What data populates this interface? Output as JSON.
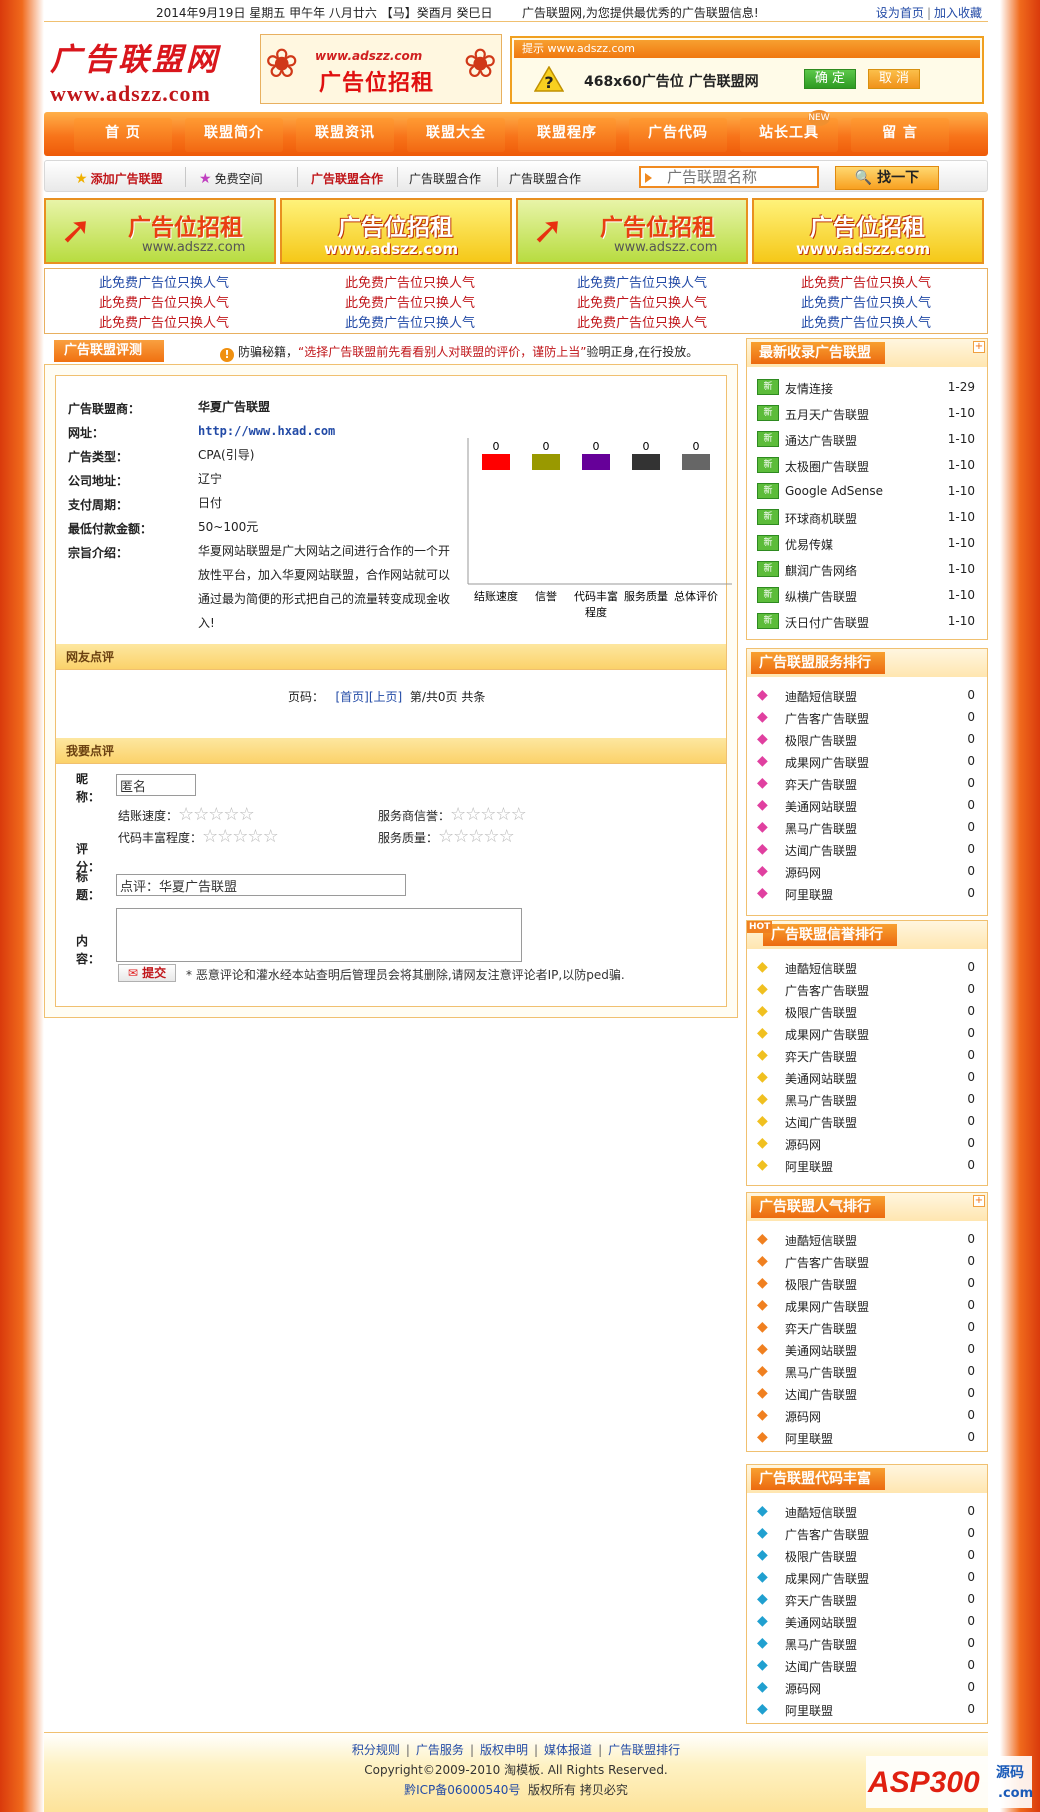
{
  "topbar": {
    "date": "2014年9月19日 星期五 甲午年 八月廿六 【马】癸酉月 癸巳日",
    "slogan": "广告联盟网,为您提供最优秀的广告联盟信息!",
    "set_home": "设为首页",
    "add_fav": "加入收藏"
  },
  "header": {
    "logo_cn": "广告联盟网",
    "logo_en": "www.adszz.com",
    "ad_url": "www.adszz.com",
    "ad_text": "广告位招租",
    "notice_bar": "提示 www.adszz.com",
    "notice_msg": "468x60广告位 广告联盟网",
    "notice_ok": "确 定",
    "notice_cancel": "取 消"
  },
  "nav": {
    "items": [
      "首 页",
      "联盟简介",
      "联盟资讯",
      "联盟大全",
      "联盟程序",
      "广告代码",
      "站长工具",
      "留 言"
    ],
    "new_badge": "NEW"
  },
  "subnav": {
    "add_union": "添加广告联盟",
    "free_space": "免费空间",
    "coop1": "广告联盟合作",
    "coop2": "广告联盟合作",
    "coop3": "广告联盟合作",
    "search_placeholder": "广告联盟名称",
    "search_btn": "找一下"
  },
  "banners": {
    "text": "广告位招租",
    "url": "www.adszz.com"
  },
  "textads": {
    "text": "此免费广告位只换人气"
  },
  "colors": {
    "accent": "#f07010",
    "link_blue": "#224aa6",
    "link_red": "#c0161a",
    "bar1": "#ff0000",
    "bar2": "#999900",
    "bar3": "#660099",
    "bar4": "#333333",
    "bar5": "#666666"
  },
  "main": {
    "tab": "广告联盟评测",
    "tip_prefix": "防骗秘籍，",
    "tip_quote": "“选择广告联盟前先看看别人对联盟的评价，谨防上当”",
    "tip_suffix": "验明正身,在行投放。",
    "info": [
      {
        "k": "广告联盟商：",
        "v": "华夏广告联盟"
      },
      {
        "k": "网址：",
        "v": "http://www.hxad.com"
      },
      {
        "k": "广告类型：",
        "v": "CPA(引导)"
      },
      {
        "k": "公司地址：",
        "v": "辽宁"
      },
      {
        "k": "支付周期：",
        "v": "日付"
      },
      {
        "k": "最低付款金额：",
        "v": "50~100元"
      },
      {
        "k": "宗旨介绍：",
        "v": "华夏网站联盟是广大网站之间进行合作的一个开放性平台，加入华夏网站联盟，合作网站就可以通过最为简便的形式把自己的流量转变成现金收入!"
      }
    ],
    "comments_title": "网友点评",
    "pager_label": "页码：",
    "pager_first": "[首页]",
    "pager_prev": "[上页]",
    "pager_status": "第/共0页 共条",
    "review_title": "我要点评",
    "form": {
      "nick_label": "昵称：",
      "nick_value": "匿名",
      "score_label": "评分：",
      "speed_label": "结账速度：",
      "credit_label": "服务商信誉：",
      "code_label": "代码丰富程度：",
      "quality_label": "服务质量：",
      "title_label": "标题：",
      "title_value": "点评：华夏广告联盟",
      "content_label": "内容：",
      "submit": "提交",
      "note": "* 恶意评论和灌水经本站查明后管理员会将其删除,请网友注意评论者IP,以防ped骗."
    }
  },
  "chart_data": {
    "type": "bar",
    "categories": [
      "结账速度",
      "信誉",
      "代码丰富程度",
      "服务质量",
      "总体评价"
    ],
    "values": [
      0,
      0,
      0,
      0,
      0
    ],
    "ylim": [
      0,
      5
    ],
    "colors": [
      "#ff0000",
      "#999900",
      "#660099",
      "#333333",
      "#666666"
    ],
    "grid": false
  },
  "side_latest": {
    "title": "最新收录广告联盟",
    "items": [
      {
        "name": "友情连接",
        "val": "1-29"
      },
      {
        "name": "五月天广告联盟",
        "val": "1-10"
      },
      {
        "name": "通达广告联盟",
        "val": "1-10"
      },
      {
        "name": "太极圈广告联盟",
        "val": "1-10"
      },
      {
        "name": "Google AdSense",
        "val": "1-10"
      },
      {
        "name": "环球商机联盟",
        "val": "1-10"
      },
      {
        "name": "优易传媒",
        "val": "1-10"
      },
      {
        "name": "麒润广告网络",
        "val": "1-10"
      },
      {
        "name": "纵横广告联盟",
        "val": "1-10"
      },
      {
        "name": "沃日付广告联盟",
        "val": "1-10"
      }
    ]
  },
  "rank_names": [
    "迪酷短信联盟",
    "广告客广告联盟",
    "极限广告联盟",
    "成果网广告联盟",
    "弈天广告联盟",
    "美通网站联盟",
    "黑马广告联盟",
    "达闻广告联盟",
    "源码网",
    "阿里联盟"
  ],
  "rank_values": [
    "0",
    "0",
    "0",
    "0",
    "0",
    "0",
    "0",
    "0",
    "0",
    "0"
  ],
  "side_service": {
    "title": "广告联盟服务排行"
  },
  "side_credit": {
    "title": "广告联盟信誉排行",
    "hot": "HOT"
  },
  "side_popular": {
    "title": "广告联盟人气排行"
  },
  "side_code": {
    "title": "广告联盟代码丰富"
  },
  "footer": {
    "links": [
      "积分规则",
      "广告服务",
      "版权申明",
      "媒体报道",
      "广告联盟排行"
    ],
    "copyright": "Copyright©2009-2010 淘模板. All Rights Reserved.",
    "icp": "黔ICP备06000540号",
    "rights": "版权所有 拷贝必究"
  },
  "watermark": {
    "brand": "ASP300",
    "src": "源码",
    "com": ".com"
  }
}
